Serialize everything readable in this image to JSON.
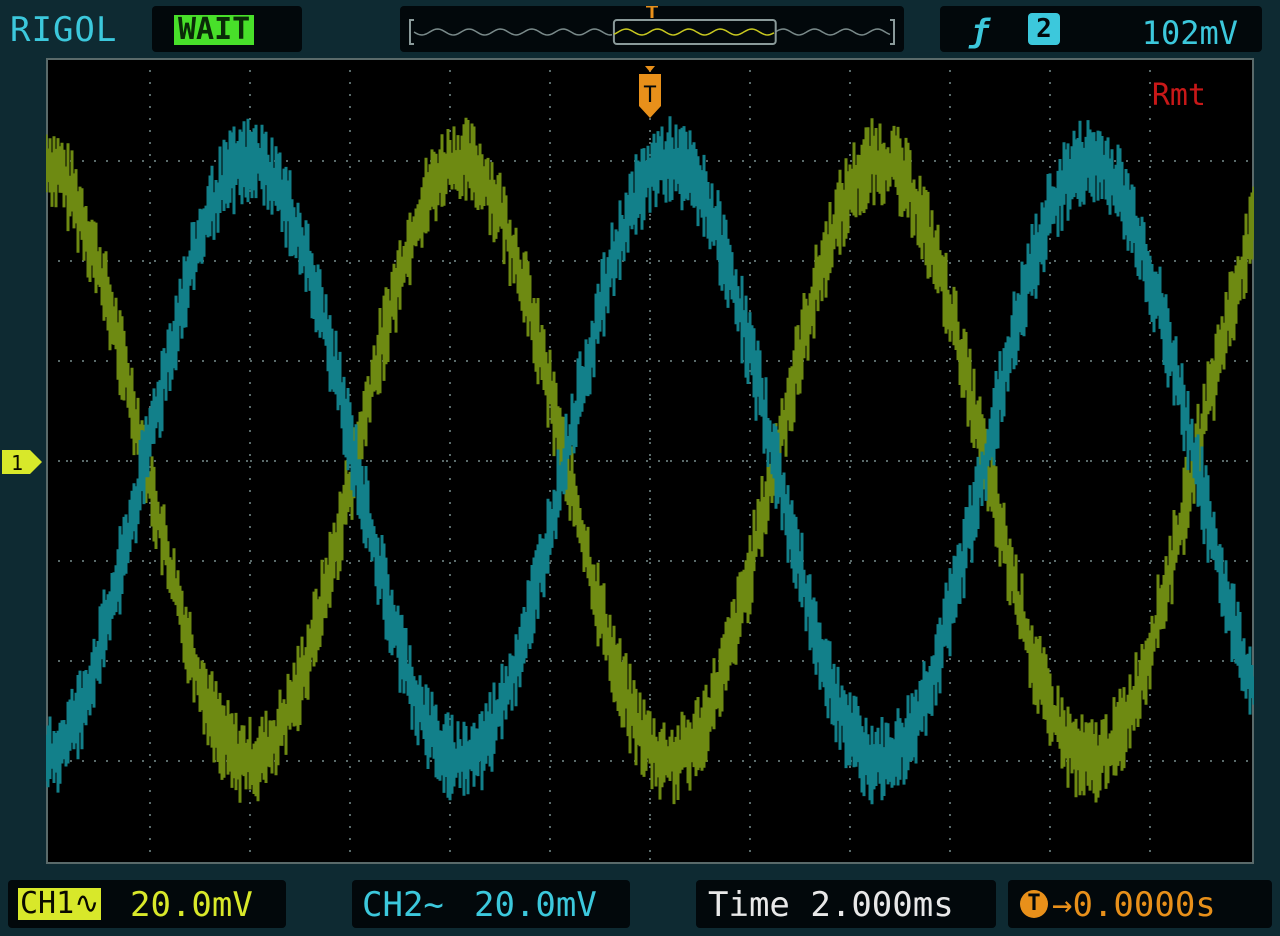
{
  "brand": "RIGOL",
  "status": "WAIT",
  "trigger": {
    "edge_icon": "rising-edge-icon",
    "source": "2",
    "level": "102mV",
    "marker": "T",
    "color": "#e8901a"
  },
  "memory_bar": {
    "view_start": 0.42,
    "view_end": 0.76
  },
  "screen": {
    "mode": "Rmt",
    "grid_divisions": {
      "x": 12,
      "y": 8
    }
  },
  "ch1_marker": "1",
  "footer": {
    "ch1_label": "CH1",
    "ch1_coupling": "∿",
    "ch1_scale": "20.0mV",
    "ch2_label": "CH2",
    "ch2_coupling": "~",
    "ch2_scale": "20.0mV",
    "time_label": "Time",
    "time_scale": "2.000ms",
    "trigger_offset": "0.0000s"
  },
  "colors": {
    "ch1": "#6e8a12",
    "ch2": "#12808a",
    "grid": "#5a6a6a",
    "text_cyan": "#3cc8dc",
    "status_green": "#48e02a",
    "rmt_red": "#c81818"
  },
  "waveforms": [
    {
      "name": "CH1",
      "color": "#6e8a12",
      "amplitude_div": 3.0,
      "period_div": 4.2,
      "phase_deg": 95,
      "noise_div": 0.35
    },
    {
      "name": "CH2",
      "color": "#12808a",
      "amplitude_div": 3.0,
      "period_div": 4.2,
      "phase_deg": -85,
      "noise_div": 0.35
    }
  ]
}
